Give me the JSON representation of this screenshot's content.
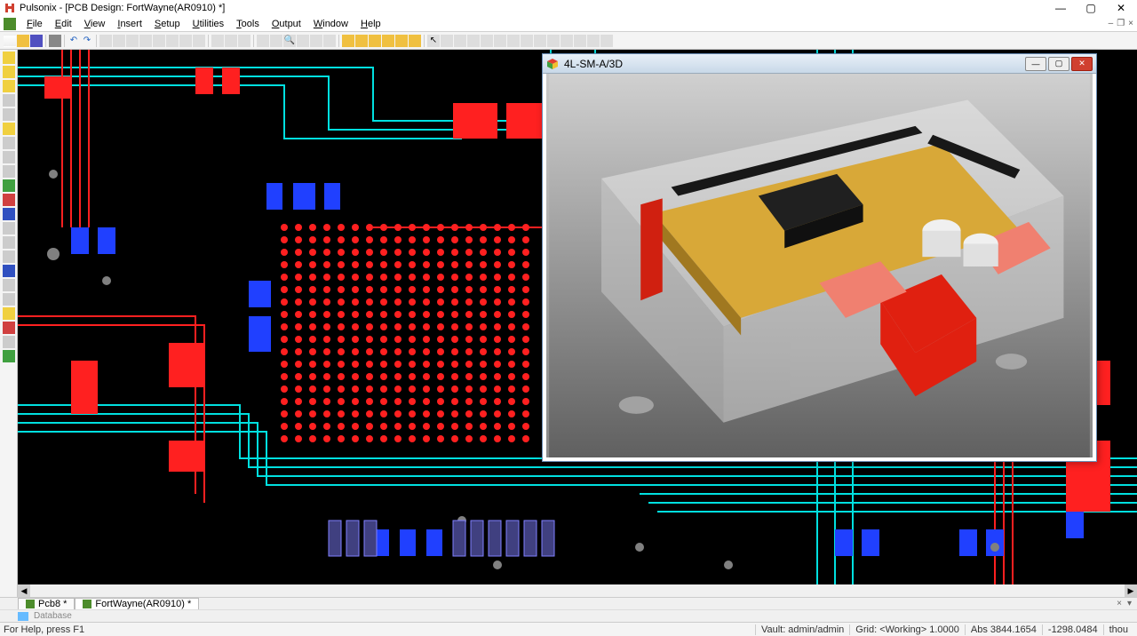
{
  "app": {
    "title": "Pulsonix - [PCB Design: FortWayne(AR0910) *]"
  },
  "menu": {
    "items": [
      "File",
      "Edit",
      "View",
      "Insert",
      "Setup",
      "Utilities",
      "Tools",
      "Output",
      "Window",
      "Help"
    ]
  },
  "float_window": {
    "title": "4L-SM-A/3D"
  },
  "tabs": {
    "items": [
      {
        "label": "Pcb8 *"
      },
      {
        "label": "FortWayne(AR0910) *"
      }
    ]
  },
  "database_panel": {
    "label": "Database"
  },
  "status": {
    "help": "For Help, press F1",
    "vault": "Vault: admin/admin",
    "grid": "Grid: <Working> 1.0000",
    "abs": "Abs 3844.1654",
    "coord": "-1298.0484",
    "unit": "thou"
  }
}
